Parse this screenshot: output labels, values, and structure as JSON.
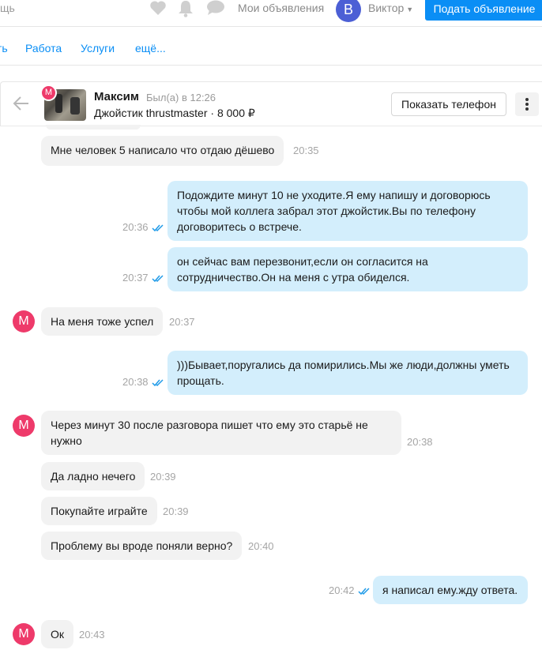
{
  "topbar": {
    "search_fragment": "щь",
    "my_ads_label": "Мои объявления",
    "user_initial": "В",
    "user_name": "Виктор",
    "post_button_label": "Подать объявление"
  },
  "categories": {
    "items": [
      "ть",
      "Работа",
      "Услуги",
      "ещё..."
    ]
  },
  "chat_header": {
    "avatar_initial": "М",
    "name": "Максим",
    "last_seen": "Был(а) в 12:26",
    "item": "Джойстик thrustmaster · 8 000 ₽",
    "phone_button_label": "Показать телефон"
  },
  "messages": [
    {
      "dir": "in",
      "text": "Мне человек 5 написало что отдаю  дёшево",
      "time": "20:35"
    },
    {
      "dir": "out",
      "text": "Подождите минут 10 не уходите.Я ему напишу и договорюсь чтобы мой коллега забрал этот джойстик.Вы по телефону договоритесь о встрече.",
      "time": "20:36"
    },
    {
      "dir": "out",
      "text": "он сейчас вам перезвонит,если он согласится на сотрудничество.Он на меня с утра обиделся.",
      "time": "20:37"
    },
    {
      "dir": "in",
      "avatar": "М",
      "text": "На меня тоже успел",
      "time": "20:37"
    },
    {
      "dir": "out",
      "text": ")))Бывает,поругались да помирились.Мы же люди,должны уметь прощать.",
      "time": "20:38"
    },
    {
      "dir": "in",
      "avatar": "М",
      "text": "Через минут 30 после разговора пишет что ему это старьё не нужно",
      "time": "20:38"
    },
    {
      "dir": "in",
      "text": "Да ладно нечего",
      "time": "20:39"
    },
    {
      "dir": "in",
      "text": "Покупайте играйте",
      "time": "20:39"
    },
    {
      "dir": "in",
      "text": "Проблему вы вроде поняли верно?",
      "time": "20:40"
    },
    {
      "dir": "out",
      "text": "я написал ему.жду ответа.",
      "time": "20:42"
    },
    {
      "dir": "in",
      "avatar": "М",
      "text": "Ок",
      "time": "20:43"
    }
  ],
  "colors": {
    "accent_blue": "#0a8ef5",
    "incoming_bubble": "#f2f2f2",
    "outgoing_bubble": "#d3eefc",
    "avatar_pink": "#ee3a6a",
    "user_avatar": "#4c5fd5",
    "read_check": "#1e9ae8"
  },
  "icons": [
    "heart-icon",
    "bell-icon",
    "chat-bubble-icon",
    "chevron-down-icon",
    "back-arrow-icon",
    "more-vertical-icon",
    "double-check-icon"
  ]
}
